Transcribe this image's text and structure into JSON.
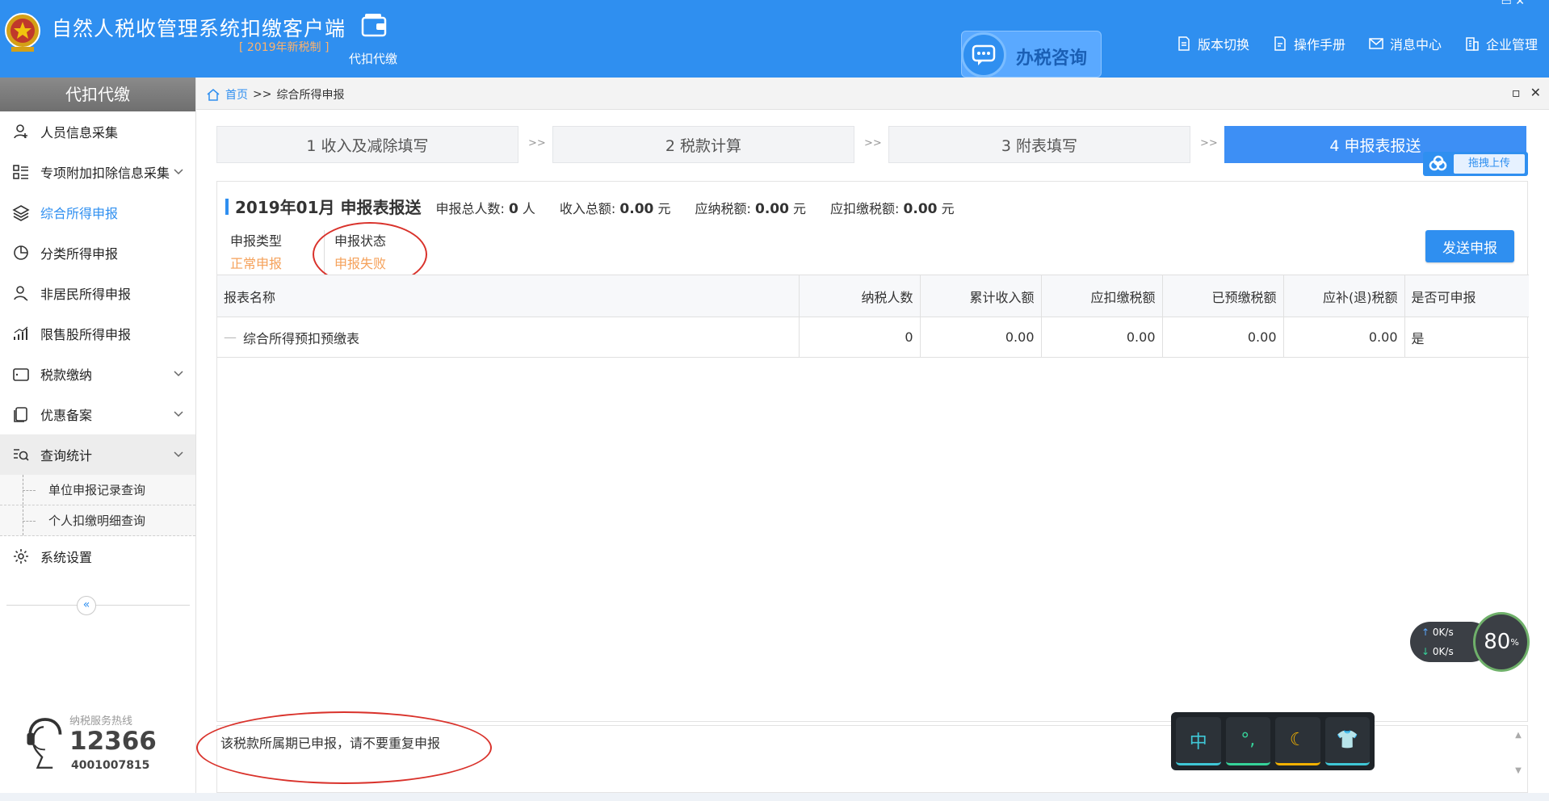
{
  "header": {
    "title": "自然人税收管理系统扣缴客户端",
    "subtitle": "[ 2019年新税制 ]",
    "module_label": "代扣代缴",
    "consult_label": "办税咨询",
    "actions": [
      {
        "label": "版本切换",
        "icon": "document-icon"
      },
      {
        "label": "操作手册",
        "icon": "manual-icon"
      },
      {
        "label": "消息中心",
        "icon": "mail-icon"
      },
      {
        "label": "企业管理",
        "icon": "building-icon"
      }
    ]
  },
  "sidebar": {
    "heading": "代扣代缴",
    "items": [
      {
        "label": "人员信息采集",
        "icon": "person-icon"
      },
      {
        "label": "专项附加扣除信息采集",
        "icon": "list-icon"
      },
      {
        "label": "综合所得申报",
        "icon": "layers-icon"
      },
      {
        "label": "分类所得申报",
        "icon": "pie-icon"
      },
      {
        "label": "非居民所得申报",
        "icon": "person-outline-icon"
      },
      {
        "label": "限售股所得申报",
        "icon": "bar-chart-icon"
      },
      {
        "label": "税款缴纳",
        "icon": "wallet-icon"
      },
      {
        "label": "优惠备案",
        "icon": "copy-icon"
      },
      {
        "label": "查询统计",
        "icon": "search-list-icon"
      },
      {
        "label": "系统设置",
        "icon": "gear-icon"
      }
    ],
    "sub_items": [
      "单位申报记录查询",
      "个人扣缴明细查询"
    ],
    "collapse_glyph": "«",
    "hotline_label": "纳税服务热线",
    "hotline_number": "12366",
    "hotline_alt": "4001007815"
  },
  "breadcrumb": {
    "home": "首页",
    "sep": ">>",
    "current": "综合所得申报"
  },
  "steps": [
    {
      "label": "1 收入及减除填写"
    },
    {
      "label": "2 税款计算"
    },
    {
      "label": "3 附表填写"
    },
    {
      "label": "4 申报表报送"
    }
  ],
  "step_sep": ">>",
  "upload_label": "拖拽上传",
  "summary": {
    "period": "2019年01月 申报表报送",
    "total_people_label": "申报总人数:",
    "total_people": "0",
    "people_unit": "人",
    "income_label": "收入总额:",
    "income": "0.00",
    "tax_payable_label": "应纳税额:",
    "tax_payable": "0.00",
    "tax_withhold_label": "应扣缴税额:",
    "tax_withhold": "0.00",
    "yuan": "元"
  },
  "filing": {
    "type_label": "申报类型",
    "type_value": "正常申报",
    "status_label": "申报状态",
    "status_value": "申报失败"
  },
  "send_button": "发送申报",
  "table": {
    "columns": [
      "报表名称",
      "纳税人数",
      "累计收入额",
      "应扣缴税额",
      "已预缴税额",
      "应补(退)税额",
      "是否可申报"
    ],
    "rows": [
      {
        "name": "综合所得预扣预缴表",
        "taxpayers": "0",
        "income": "0.00",
        "withhold": "0.00",
        "prepaid": "0.00",
        "due": "0.00",
        "can_file": "是"
      }
    ]
  },
  "message": "该税款所属期已申报，请不要重复申报",
  "netmon": {
    "up": "0K/s",
    "down": "0K/s",
    "percent": "80"
  },
  "ime_keys": [
    "中",
    "°,",
    "☾",
    "👕"
  ]
}
